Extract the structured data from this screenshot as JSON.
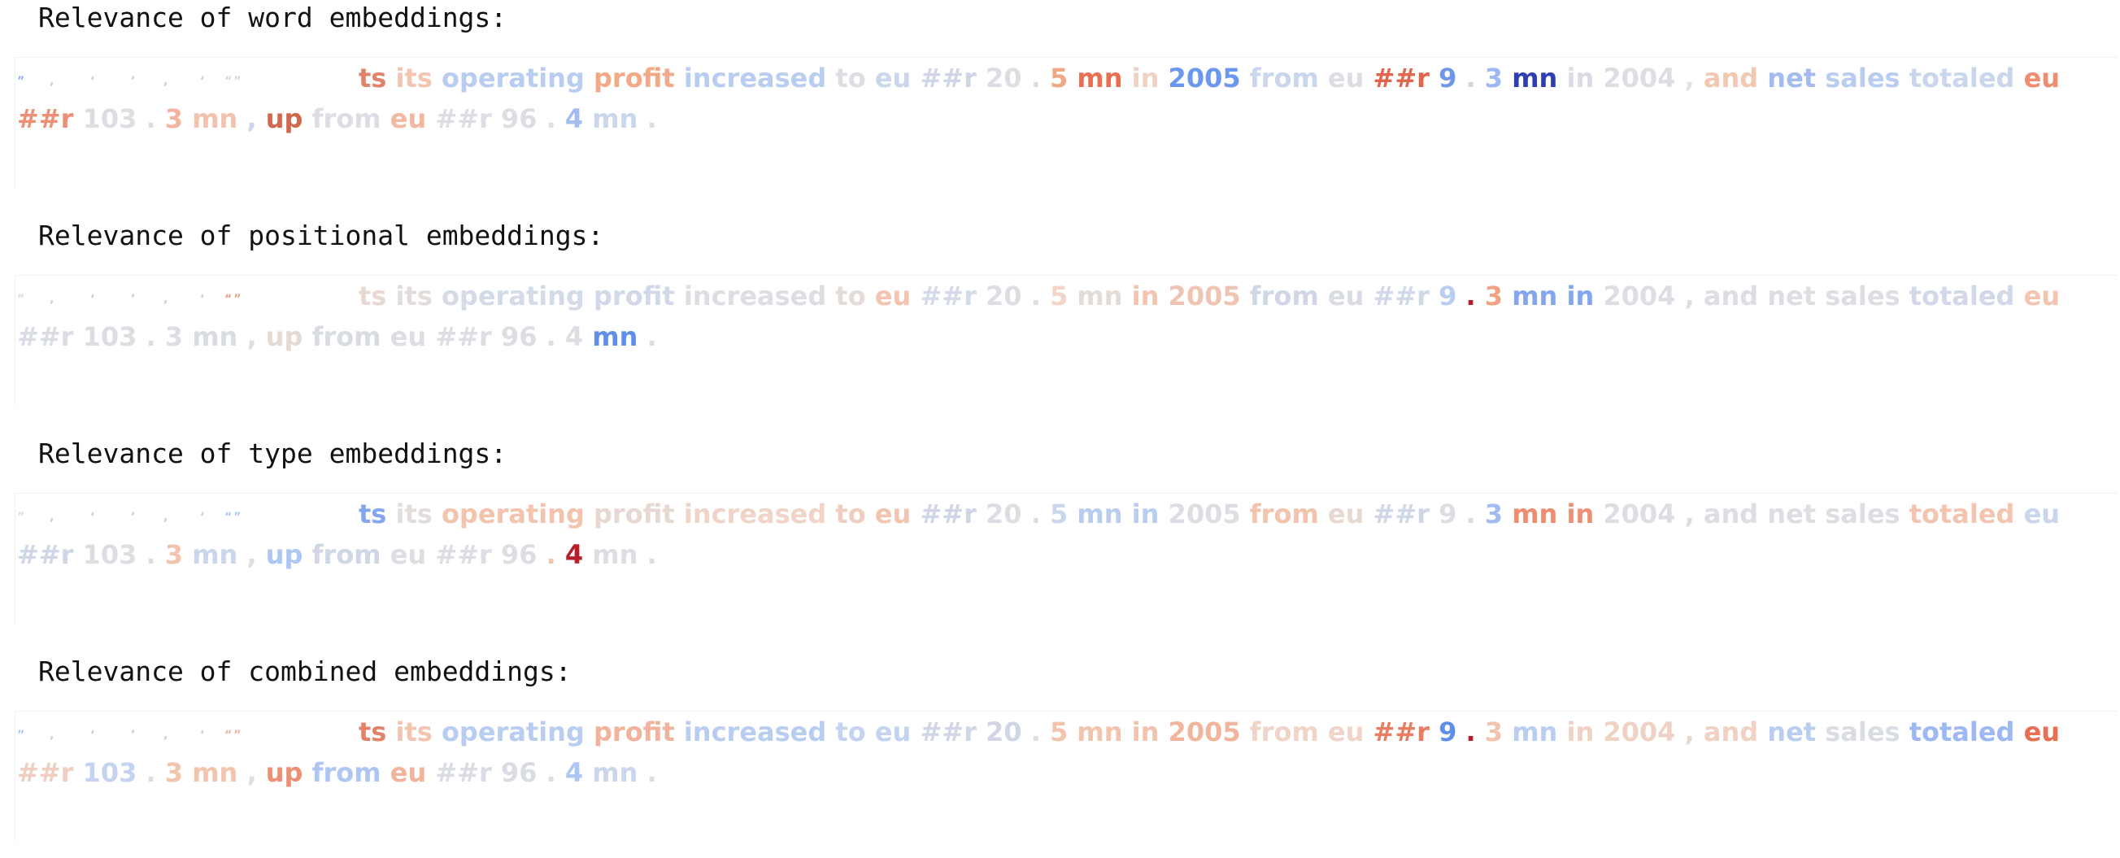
{
  "sections": [
    {
      "title": "Relevance of word embeddings:",
      "start_color": "#8fb0ee",
      "end_color": "#cfd6e6"
    },
    {
      "title": "Relevance of positional embeddings:",
      "start_color": "#d9dce3",
      "end_color": "#e9a08a"
    },
    {
      "title": "Relevance of type embeddings:",
      "start_color": "#d9dce3",
      "end_color": "#aec6f3"
    },
    {
      "title": "Relevance of combined embeddings:",
      "start_color": "#aec6f3",
      "end_color": "#e9b39c"
    }
  ],
  "pad_marks": [
    "”",
    ",",
    "‘",
    "’",
    ",",
    "‘",
    "“”"
  ],
  "tokens": [
    "ts",
    "its",
    "operating",
    "profit",
    "increased",
    "to",
    "eu",
    "##r",
    "20",
    ".",
    "5",
    "mn",
    "in",
    "2005",
    "from",
    "eu",
    "##r",
    "9",
    ".",
    "3",
    "mn",
    "in",
    "2004",
    ",",
    "and",
    "net",
    "sales",
    "totaled",
    "eu",
    "##r",
    "103",
    ".",
    "3",
    "mn",
    ",",
    "up",
    "from",
    "eu",
    "##r",
    "96",
    ".",
    "4",
    "mn",
    "."
  ],
  "colors": [
    [
      "#e0836a",
      "#f3c5b1",
      "#b9cdf1",
      "#f2a988",
      "#b9cdf1",
      "#dcdee3",
      "#cad6ec",
      "#cfd6e6",
      "#dcdee3",
      "#dcdee3",
      "#f0a785",
      "#e96f52",
      "#f0d2c4",
      "#6b98ee",
      "#cad6ec",
      "#dcdee3",
      "#e1664d",
      "#6f96ea",
      "#cfd6e6",
      "#9db8f2",
      "#2f3fb2",
      "#d9dce3",
      "#dcdee3",
      "#e8e1de",
      "#f2c8b2",
      "#a3bbf0",
      "#b9cdf1",
      "#cad6ec",
      "#ee8d70",
      "#ec8f74",
      "#dcdee3",
      "#dcdee3",
      "#f2b3a0",
      "#f2c2ad",
      "#cad6ec",
      "#d3674c",
      "#dcdee3",
      "#f2b8a0",
      "#dcdee3",
      "#dcdee3",
      "#dcdee3",
      "#a2bcf2",
      "#cad6ec",
      "#dcdee3"
    ],
    [
      "#e7d8d1",
      "#e2dddb",
      "#d3dbe8",
      "#d0d8ea",
      "#dcdee3",
      "#e4dcd9",
      "#f3c5b1",
      "#d3dbe8",
      "#dcdee3",
      "#dcdee3",
      "#f3d4c6",
      "#e3dbd6",
      "#f3c5b1",
      "#f0c4b2",
      "#cfd6e6",
      "#d9dce3",
      "#d0d8ea",
      "#b9cdf1",
      "#b81e29",
      "#f2a183",
      "#84a6ee",
      "#84a6ee",
      "#dcdee3",
      "#dcdee3",
      "#dcdee3",
      "#dcdee3",
      "#dcdee3",
      "#d0d8ea",
      "#f3c5b1",
      "#d9dce3",
      "#dcdee3",
      "#dcdee3",
      "#dcdee3",
      "#d9dce3",
      "#dcdee3",
      "#e5dad4",
      "#d9dce3",
      "#dcdee3",
      "#dcdee3",
      "#dcdee3",
      "#dcdee3",
      "#dcdee3",
      "#5f8fe8",
      "#dcdee3"
    ],
    [
      "#84a6ee",
      "#e2dddb",
      "#f2c3ad",
      "#e7d8d1",
      "#efd4c7",
      "#efcdbf",
      "#f3c5b1",
      "#cfd6e6",
      "#dcdee3",
      "#dcdee3",
      "#cad6ec",
      "#b9cdf1",
      "#b9cdf1",
      "#dcdee3",
      "#f2c3ad",
      "#e7d8d1",
      "#cfd6e6",
      "#dcdee3",
      "#d9dce3",
      "#a2bcf2",
      "#ee8d70",
      "#ec8f74",
      "#dcdee3",
      "#dcdee3",
      "#dcdee3",
      "#dcdee3",
      "#dcdee3",
      "#f3c5b1",
      "#cad6ec",
      "#cfd6e6",
      "#dcdee3",
      "#dcdee3",
      "#f2c3ad",
      "#cad6ec",
      "#dcdee3",
      "#aec6f3",
      "#cfd6e6",
      "#dcdee3",
      "#dcdee3",
      "#dcdee3",
      "#f2c3ad",
      "#b81e29",
      "#dcdee3"
    ],
    [
      "#e0836a",
      "#f3c5b1",
      "#b9cdf1",
      "#f2b39c",
      "#b9cdf1",
      "#c4d3ef",
      "#c4d3ef",
      "#cfd6e6",
      "#cfd6e6",
      "#dcdee3",
      "#f2c3ad",
      "#f2c3ad",
      "#f2c3ad",
      "#f0b59b",
      "#efd4c7",
      "#efd4c7",
      "#e87d62",
      "#5f8fe8",
      "#b81e29",
      "#f2c3ad",
      "#b9cdf1",
      "#f0d2c4",
      "#f0d2c4",
      "#e7d8d1",
      "#f0d2c4",
      "#b9cdf1",
      "#d9dce3",
      "#9db8f2",
      "#e96f52",
      "#efcdbf",
      "#c4d3ef",
      "#dcdee3",
      "#f2c3ad",
      "#f2c3ad",
      "#dcdee3",
      "#ec8f74",
      "#aec6f3",
      "#f2b39c",
      "#d9dce3",
      "#d9dce3",
      "#dcdee3",
      "#aec6f3",
      "#cad6ec",
      "#dcdee3"
    ]
  ]
}
